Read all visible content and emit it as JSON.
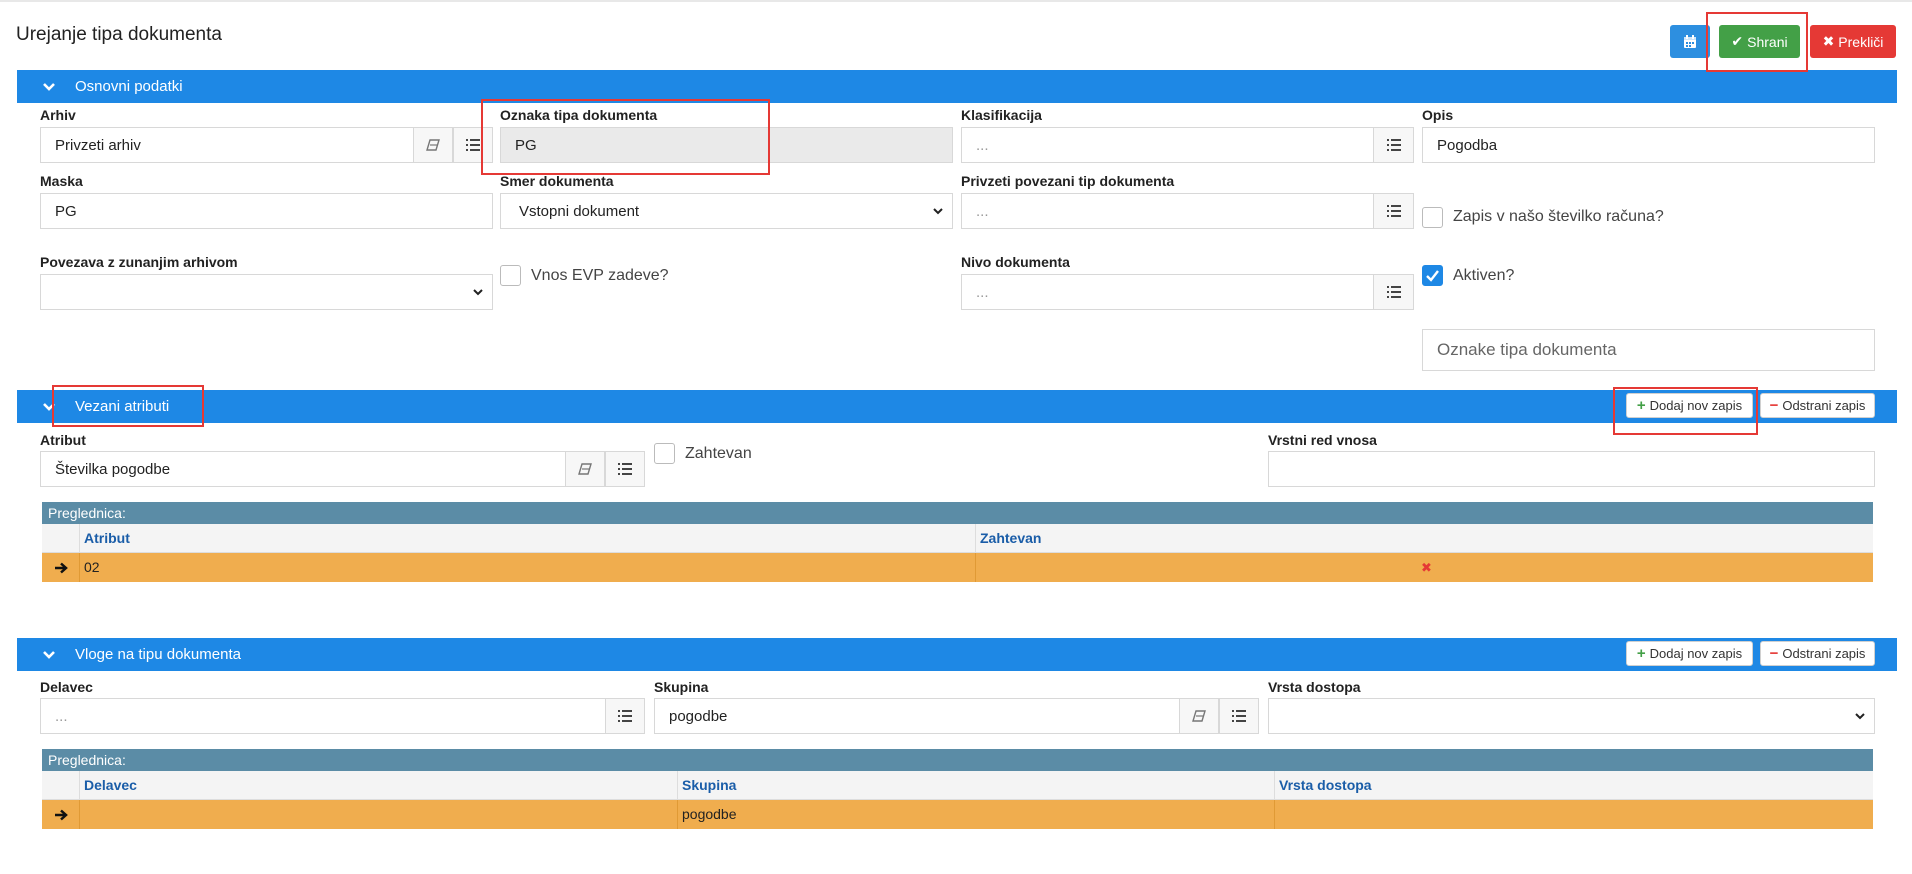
{
  "page_title": "Urejanje tipa dokumenta",
  "header_buttons": {
    "save": "Shrani",
    "cancel": "Prekliči"
  },
  "colors": {
    "primary": "#1e88e5",
    "success": "#43a047",
    "danger": "#e53935",
    "grid_caption": "#5b8ca6",
    "grid_row": "#f0ad4e"
  },
  "osnovni": {
    "section_title": "Osnovni podatki",
    "arhiv": {
      "label": "Arhiv",
      "value": "Privzeti arhiv"
    },
    "oznaka": {
      "label": "Oznaka tipa dokumenta",
      "value": "PG"
    },
    "klasifikacija": {
      "label": "Klasifikacija",
      "placeholder": "..."
    },
    "opis": {
      "label": "Opis",
      "value": "Pogodba"
    },
    "maska": {
      "label": "Maska",
      "value": "PG"
    },
    "smer": {
      "label": "Smer dokumenta",
      "value": "Vstopni dokument"
    },
    "povezani": {
      "label": "Privzeti povezani tip dokumenta",
      "placeholder": "..."
    },
    "zapis_stevilka": {
      "label": "Zapis v našo številko računa?",
      "checked": false
    },
    "povezava": {
      "label": "Povezava z zunanjim arhivom",
      "value": ""
    },
    "vnos_evp": {
      "label": "Vnos EVP zadeve?",
      "checked": false
    },
    "nivo": {
      "label": "Nivo dokumenta",
      "placeholder": "..."
    },
    "aktiven": {
      "label": "Aktiven?",
      "checked": true
    },
    "oznake": {
      "placeholder": "Oznake tipa dokumenta"
    }
  },
  "vezani": {
    "section_title": "Vezani atributi",
    "add_label": "Dodaj nov zapis",
    "remove_label": "Odstrani zapis",
    "atribut": {
      "label": "Atribut",
      "value": "Številka pogodbe"
    },
    "zahtevan": {
      "label": "Zahtevan",
      "checked": false
    },
    "vrstni_red": {
      "label": "Vrstni red vnosa",
      "value": ""
    },
    "grid": {
      "caption": "Preglednica:",
      "columns": [
        "Atribut",
        "Zahtevan"
      ],
      "rows": [
        {
          "atribut": "02",
          "zahtevan": false
        }
      ]
    }
  },
  "vloge": {
    "section_title": "Vloge na tipu dokumenta",
    "add_label": "Dodaj nov zapis",
    "remove_label": "Odstrani zapis",
    "delavec": {
      "label": "Delavec",
      "placeholder": "..."
    },
    "skupina": {
      "label": "Skupina",
      "value": "pogodbe"
    },
    "vrsta_dostopa": {
      "label": "Vrsta dostopa",
      "value": ""
    },
    "grid": {
      "caption": "Preglednica:",
      "columns": [
        "Delavec",
        "Skupina",
        "Vrsta dostopa"
      ],
      "rows": [
        {
          "delavec": "",
          "skupina": "pogodbe",
          "vrsta_dostopa": ""
        }
      ]
    }
  }
}
